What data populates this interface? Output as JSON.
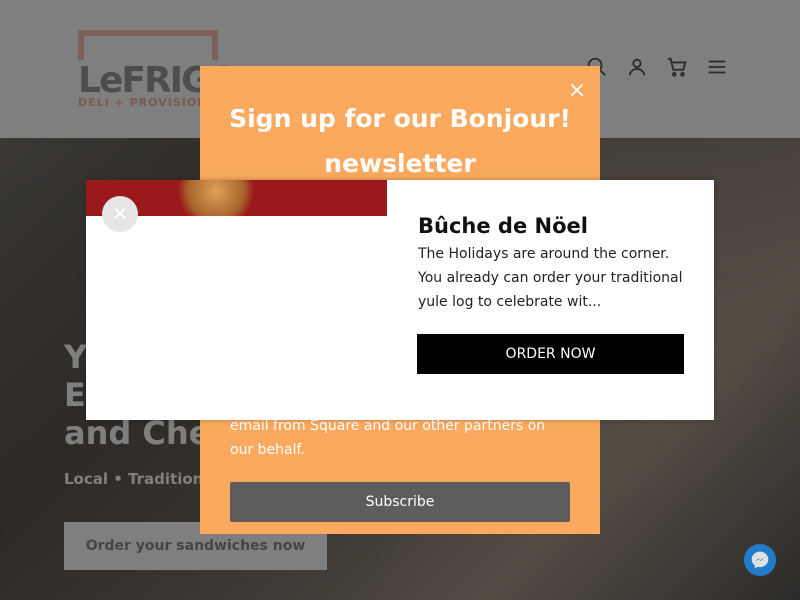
{
  "header": {
    "logo_text": "LeFRIGO",
    "logo_sub": "DELI + PROVISIONS",
    "icons": [
      "search-icon",
      "account-icon",
      "cart-icon",
      "menu-icon"
    ]
  },
  "hero": {
    "title_lines": [
      "Yo",
      "E",
      "and Chee"
    ],
    "subtitle": "Local • Tradition •",
    "button_label": "Order your sandwiches now"
  },
  "newsletter": {
    "title": "Sign up for our Bonjour! newsletter",
    "body": "email from Square and our other partners on our behalf.",
    "subscribe_label": "Subscribe",
    "close_glyph": "×",
    "bg_color": "#fba95f"
  },
  "promo": {
    "title": "Bûche de Nöel",
    "description": "The Holidays are around the corner. You already can order your traditional yule log to celebrate wit...",
    "button_label": "ORDER NOW",
    "close_glyph": "×"
  }
}
